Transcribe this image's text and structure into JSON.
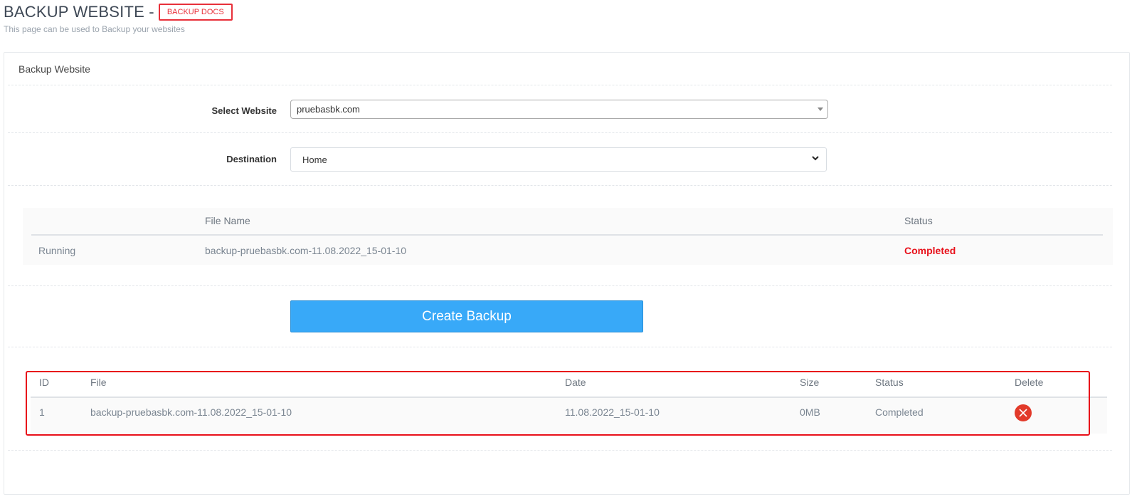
{
  "header": {
    "title": "BACKUP WEBSITE -",
    "docs_badge": "BACKUP DOCS",
    "subtitle": "This page can be used to Backup your websites"
  },
  "panel": {
    "title": "Backup Website"
  },
  "form": {
    "select_website_label": "Select Website",
    "select_website_value": "pruebasbk.com",
    "destination_label": "Destination",
    "destination_value": "Home"
  },
  "progress_table": {
    "headers": [
      "",
      "File Name",
      "Status"
    ],
    "row": {
      "state": "Running",
      "file_name": "backup-pruebasbk.com-11.08.2022_15-01-10",
      "status": "Completed"
    }
  },
  "create_button_label": "Create Backup",
  "backups_table": {
    "headers": [
      "ID",
      "File",
      "Date",
      "Size",
      "Status",
      "Delete"
    ],
    "rows": [
      {
        "id": "1",
        "file": "backup-pruebasbk.com-11.08.2022_15-01-10",
        "date": "11.08.2022_15-01-10",
        "size": "0MB",
        "status": "Completed",
        "delete_icon": "delete-icon"
      }
    ]
  },
  "colors": {
    "accent_blue": "#38a9f8",
    "alert_red": "#e8101a",
    "delete_red": "#e23a2a"
  }
}
